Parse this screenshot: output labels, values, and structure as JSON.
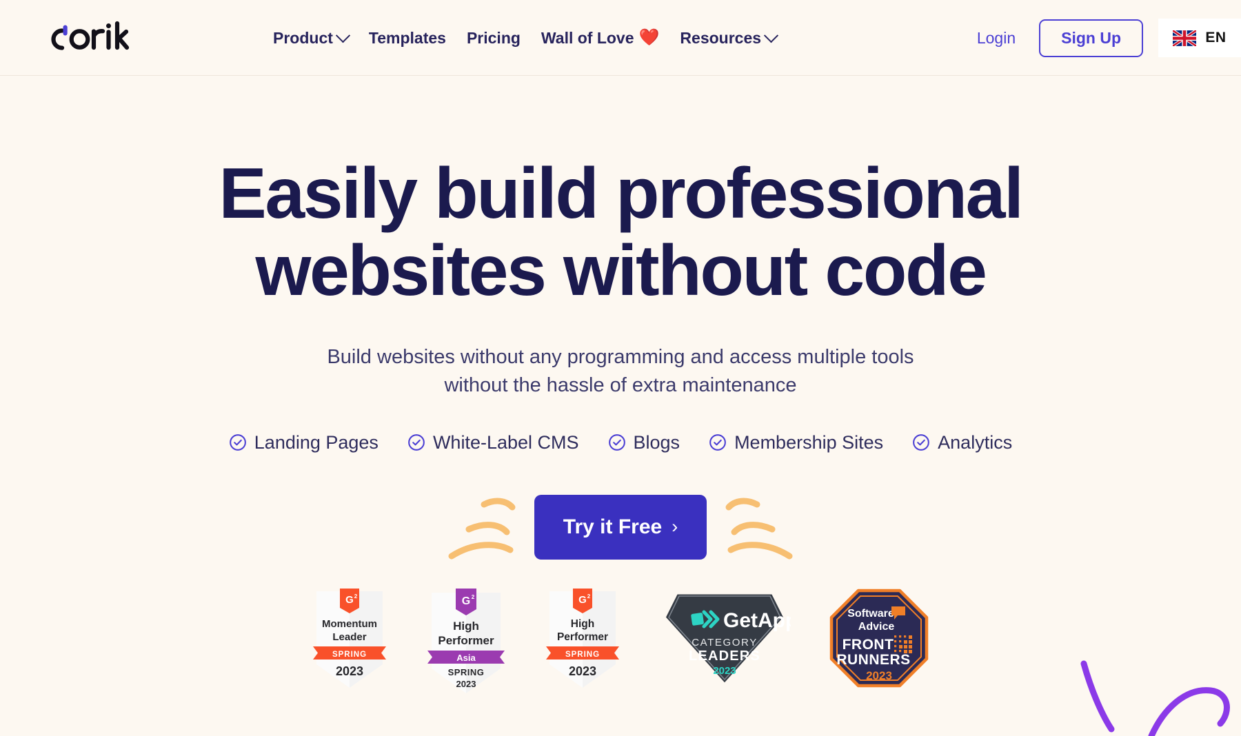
{
  "brand": {
    "name": "dorik",
    "logo_icon": "dorik-logo",
    "accent_purple": "#4b3fd4",
    "deep_purple": "#3a30bf",
    "navy": "#1b1a4e",
    "page_background": "#fdf8f1"
  },
  "header": {
    "nav": [
      {
        "label": "Product",
        "name": "nav-item-product",
        "has_chevron": true,
        "icon": "chevron-down-icon"
      },
      {
        "label": "Templates",
        "name": "nav-item-templates",
        "has_chevron": false,
        "icon": ""
      },
      {
        "label": "Pricing",
        "name": "nav-item-pricing",
        "has_chevron": false,
        "icon": ""
      },
      {
        "label": "Wall of Love",
        "name": "nav-item-wall-of-love",
        "has_chevron": false,
        "icon": "heart-icon",
        "emoji": "❤️"
      },
      {
        "label": "Resources",
        "name": "nav-item-resources",
        "has_chevron": true,
        "icon": "chevron-down-icon"
      }
    ],
    "login_label": "Login",
    "signup_label": "Sign Up",
    "language": {
      "code": "EN",
      "flag": "uk-flag-icon"
    }
  },
  "hero": {
    "headline_line1": "Easily build professional",
    "headline_line2": "websites without code",
    "subhead_line1": "Build websites without any programming and access multiple tools",
    "subhead_line2": "without the hassle of extra maintenance",
    "features": [
      {
        "label": "Landing Pages",
        "icon": "check-circle-icon"
      },
      {
        "label": "White-Label CMS",
        "icon": "check-circle-icon"
      },
      {
        "label": "Blogs",
        "icon": "check-circle-icon"
      },
      {
        "label": "Membership Sites",
        "icon": "check-circle-icon"
      },
      {
        "label": "Analytics",
        "icon": "check-circle-icon"
      }
    ],
    "cta_label": "Try it Free",
    "cta_arrow": "›",
    "doodle_color": "#f7bf72"
  },
  "badges": [
    {
      "name": "badge-g2-momentum-leader",
      "provider": "G2",
      "title_line1": "Momentum",
      "title_line2": "Leader",
      "ribbon": "SPRING",
      "year": "2023",
      "accent": "#f9512a",
      "shape": "shield"
    },
    {
      "name": "badge-g2-high-performer-asia",
      "provider": "G2",
      "title_line1": "High",
      "title_line2": "Performer",
      "ribbon": "Asia",
      "sub_line1": "SPRING",
      "year": "2023",
      "accent": "#9b3bb0",
      "shape": "shield"
    },
    {
      "name": "badge-g2-high-performer",
      "provider": "G2",
      "title_line1": "High",
      "title_line2": "Performer",
      "ribbon": "SPRING",
      "year": "2023",
      "accent": "#f9512a",
      "shape": "shield"
    },
    {
      "name": "badge-getapp-category-leaders",
      "provider": "GetApp",
      "title_line1": "CATEGORY",
      "title_line2": "LEADERS",
      "year": "2023",
      "accent": "#2dd4c4",
      "background": "#353b44",
      "shape": "diamond"
    },
    {
      "name": "badge-software-advice-front-runners",
      "provider_line1": "Software",
      "provider_line2": "Advice",
      "title_line1": "FRONT",
      "title_line2": "RUNNERS",
      "year": "2023",
      "accent": "#f07f28",
      "background": "#2b2a55",
      "shape": "hexagon"
    }
  ],
  "decorations": {
    "scribble_color": "#8b3ae8",
    "scribble_name": "purple-scribble-decoration"
  }
}
